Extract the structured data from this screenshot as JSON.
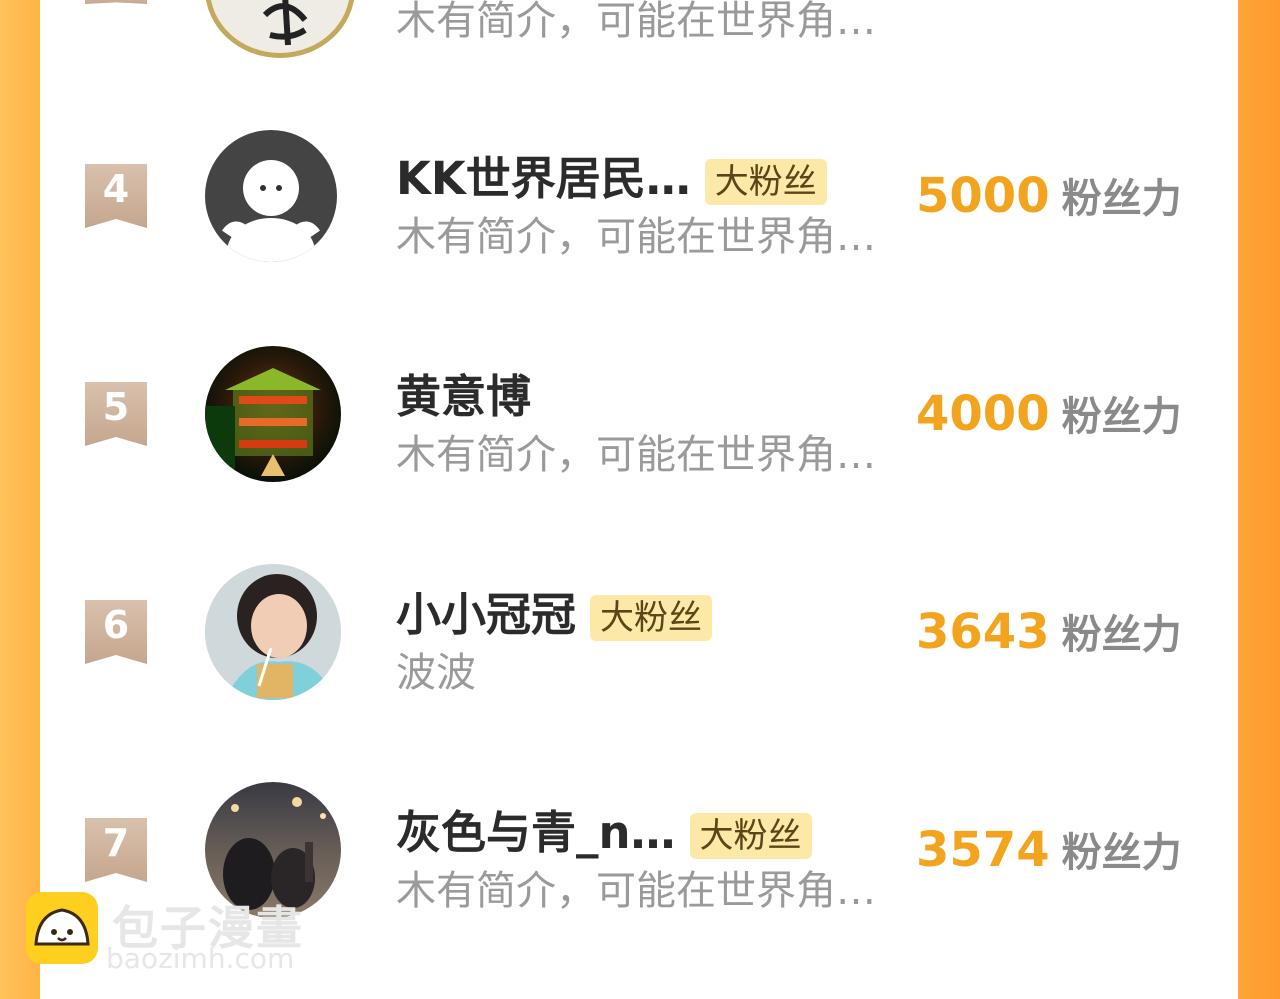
{
  "unit_label": "粉丝力",
  "top_partial": {
    "bio": "木有简介，可能在世界角…"
  },
  "entries": [
    {
      "rank": "4",
      "name": "KK世界居民…",
      "badge": "大粉丝",
      "bio": "木有简介，可能在世界角…",
      "fans": "5000"
    },
    {
      "rank": "5",
      "name": "黄意博",
      "badge": "",
      "bio": "木有简介，可能在世界角…",
      "fans": "4000"
    },
    {
      "rank": "6",
      "name": "小小冠冠",
      "badge": "大粉丝",
      "bio": "波波",
      "fans": "3643"
    },
    {
      "rank": "7",
      "name": "灰色与青_n…",
      "badge": "大粉丝",
      "bio": "木有简介，可能在世界角…",
      "fans": "3574"
    }
  ],
  "watermark": {
    "title": "包子漫畫",
    "url": "baozimh.com"
  },
  "colors": {
    "accent": "#f3a41f",
    "badge_bg": "#fde9a7",
    "rank_bg": "#d9c1ad",
    "side": "#ffa437"
  }
}
